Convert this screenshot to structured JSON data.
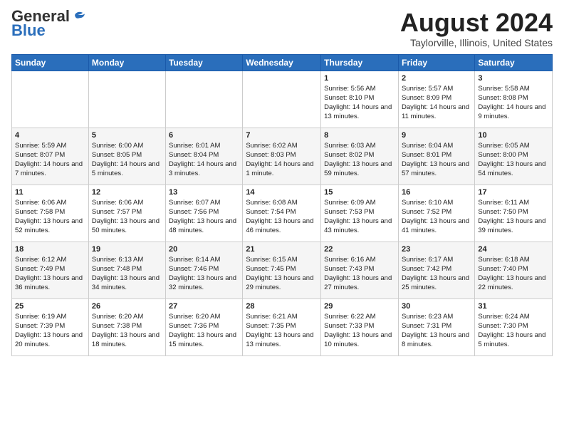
{
  "header": {
    "logo_general": "General",
    "logo_blue": "Blue",
    "month": "August 2024",
    "location": "Taylorville, Illinois, United States"
  },
  "days_of_week": [
    "Sunday",
    "Monday",
    "Tuesday",
    "Wednesday",
    "Thursday",
    "Friday",
    "Saturday"
  ],
  "weeks": [
    [
      {
        "day": "",
        "empty": true
      },
      {
        "day": "",
        "empty": true
      },
      {
        "day": "",
        "empty": true
      },
      {
        "day": "",
        "empty": true
      },
      {
        "day": "1",
        "sunrise": "5:56 AM",
        "sunset": "8:10 PM",
        "daylight": "14 hours and 13 minutes."
      },
      {
        "day": "2",
        "sunrise": "5:57 AM",
        "sunset": "8:09 PM",
        "daylight": "14 hours and 11 minutes."
      },
      {
        "day": "3",
        "sunrise": "5:58 AM",
        "sunset": "8:08 PM",
        "daylight": "14 hours and 9 minutes."
      }
    ],
    [
      {
        "day": "4",
        "sunrise": "5:59 AM",
        "sunset": "8:07 PM",
        "daylight": "14 hours and 7 minutes."
      },
      {
        "day": "5",
        "sunrise": "6:00 AM",
        "sunset": "8:05 PM",
        "daylight": "14 hours and 5 minutes."
      },
      {
        "day": "6",
        "sunrise": "6:01 AM",
        "sunset": "8:04 PM",
        "daylight": "14 hours and 3 minutes."
      },
      {
        "day": "7",
        "sunrise": "6:02 AM",
        "sunset": "8:03 PM",
        "daylight": "14 hours and 1 minute."
      },
      {
        "day": "8",
        "sunrise": "6:03 AM",
        "sunset": "8:02 PM",
        "daylight": "13 hours and 59 minutes."
      },
      {
        "day": "9",
        "sunrise": "6:04 AM",
        "sunset": "8:01 PM",
        "daylight": "13 hours and 57 minutes."
      },
      {
        "day": "10",
        "sunrise": "6:05 AM",
        "sunset": "8:00 PM",
        "daylight": "13 hours and 54 minutes."
      }
    ],
    [
      {
        "day": "11",
        "sunrise": "6:06 AM",
        "sunset": "7:58 PM",
        "daylight": "13 hours and 52 minutes."
      },
      {
        "day": "12",
        "sunrise": "6:06 AM",
        "sunset": "7:57 PM",
        "daylight": "13 hours and 50 minutes."
      },
      {
        "day": "13",
        "sunrise": "6:07 AM",
        "sunset": "7:56 PM",
        "daylight": "13 hours and 48 minutes."
      },
      {
        "day": "14",
        "sunrise": "6:08 AM",
        "sunset": "7:54 PM",
        "daylight": "13 hours and 46 minutes."
      },
      {
        "day": "15",
        "sunrise": "6:09 AM",
        "sunset": "7:53 PM",
        "daylight": "13 hours and 43 minutes."
      },
      {
        "day": "16",
        "sunrise": "6:10 AM",
        "sunset": "7:52 PM",
        "daylight": "13 hours and 41 minutes."
      },
      {
        "day": "17",
        "sunrise": "6:11 AM",
        "sunset": "7:50 PM",
        "daylight": "13 hours and 39 minutes."
      }
    ],
    [
      {
        "day": "18",
        "sunrise": "6:12 AM",
        "sunset": "7:49 PM",
        "daylight": "13 hours and 36 minutes."
      },
      {
        "day": "19",
        "sunrise": "6:13 AM",
        "sunset": "7:48 PM",
        "daylight": "13 hours and 34 minutes."
      },
      {
        "day": "20",
        "sunrise": "6:14 AM",
        "sunset": "7:46 PM",
        "daylight": "13 hours and 32 minutes."
      },
      {
        "day": "21",
        "sunrise": "6:15 AM",
        "sunset": "7:45 PM",
        "daylight": "13 hours and 29 minutes."
      },
      {
        "day": "22",
        "sunrise": "6:16 AM",
        "sunset": "7:43 PM",
        "daylight": "13 hours and 27 minutes."
      },
      {
        "day": "23",
        "sunrise": "6:17 AM",
        "sunset": "7:42 PM",
        "daylight": "13 hours and 25 minutes."
      },
      {
        "day": "24",
        "sunrise": "6:18 AM",
        "sunset": "7:40 PM",
        "daylight": "13 hours and 22 minutes."
      }
    ],
    [
      {
        "day": "25",
        "sunrise": "6:19 AM",
        "sunset": "7:39 PM",
        "daylight": "13 hours and 20 minutes."
      },
      {
        "day": "26",
        "sunrise": "6:20 AM",
        "sunset": "7:38 PM",
        "daylight": "13 hours and 18 minutes."
      },
      {
        "day": "27",
        "sunrise": "6:20 AM",
        "sunset": "7:36 PM",
        "daylight": "13 hours and 15 minutes."
      },
      {
        "day": "28",
        "sunrise": "6:21 AM",
        "sunset": "7:35 PM",
        "daylight": "13 hours and 13 minutes."
      },
      {
        "day": "29",
        "sunrise": "6:22 AM",
        "sunset": "7:33 PM",
        "daylight": "13 hours and 10 minutes."
      },
      {
        "day": "30",
        "sunrise": "6:23 AM",
        "sunset": "7:31 PM",
        "daylight": "13 hours and 8 minutes."
      },
      {
        "day": "31",
        "sunrise": "6:24 AM",
        "sunset": "7:30 PM",
        "daylight": "13 hours and 5 minutes."
      }
    ]
  ]
}
